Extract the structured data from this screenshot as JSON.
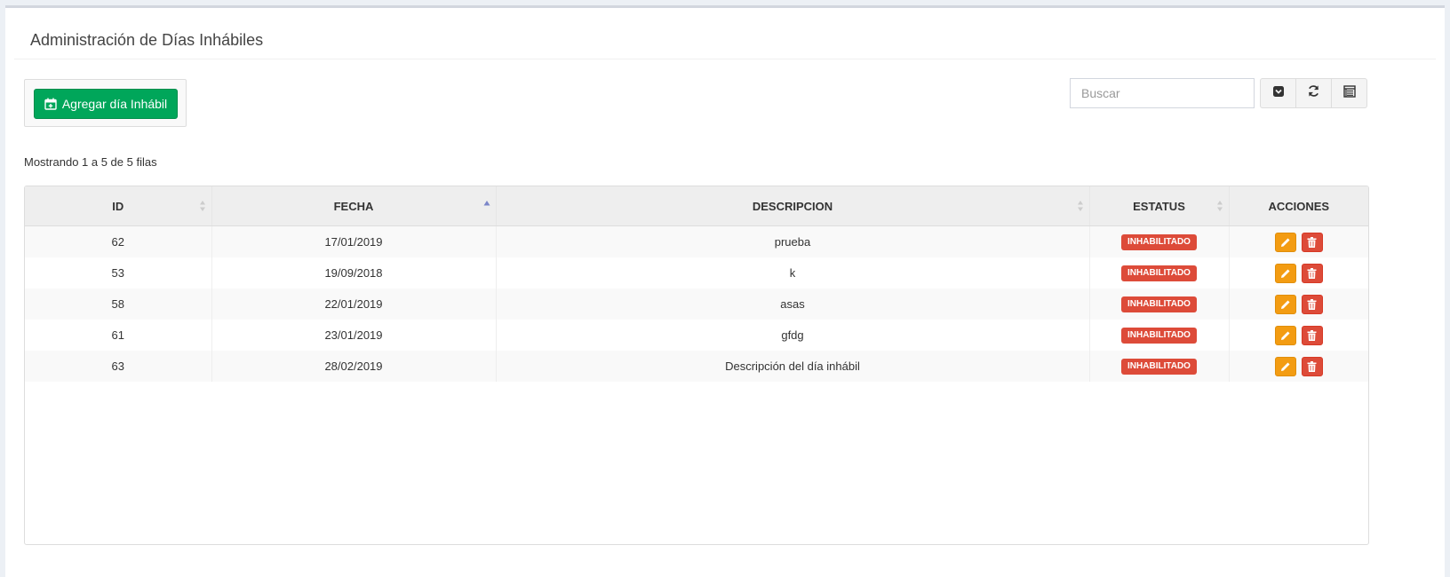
{
  "page": {
    "title": "Administración de Días Inhábiles"
  },
  "toolbar": {
    "add_label": "Agregar día Inhábil",
    "add_icon": "calendar-plus-icon",
    "accent": "#00a65a"
  },
  "search": {
    "placeholder": "Buscar",
    "value": ""
  },
  "tools": [
    {
      "icon": "toggle-icon",
      "name": "toggle"
    },
    {
      "icon": "refresh-icon",
      "name": "refresh"
    },
    {
      "icon": "columns-icon",
      "name": "columns"
    }
  ],
  "pagination": {
    "info": "Mostrando 1 a 5 de 5 filas"
  },
  "table": {
    "headers": [
      "ID",
      "FECHA",
      "DESCRIPCION",
      "ESTATUS",
      "ACCIONES"
    ],
    "sort": {
      "column": "FECHA",
      "direction": "asc"
    },
    "rows": [
      {
        "id": "62",
        "fecha": "17/01/2019",
        "descripcion": "prueba",
        "estatus": "INHABILITADO"
      },
      {
        "id": "53",
        "fecha": "19/09/2018",
        "descripcion": "k",
        "estatus": "INHABILITADO"
      },
      {
        "id": "58",
        "fecha": "22/01/2019",
        "descripcion": "asas",
        "estatus": "INHABILITADO"
      },
      {
        "id": "61",
        "fecha": "23/01/2019",
        "descripcion": "gfdg",
        "estatus": "INHABILITADO"
      },
      {
        "id": "63",
        "fecha": "28/02/2019",
        "descripcion": "Descripción del día inhábil",
        "estatus": "INHABILITADO"
      }
    ]
  },
  "colors": {
    "badge": "#dd4b39",
    "edit": "#f39c12",
    "delete": "#dd4b39"
  }
}
